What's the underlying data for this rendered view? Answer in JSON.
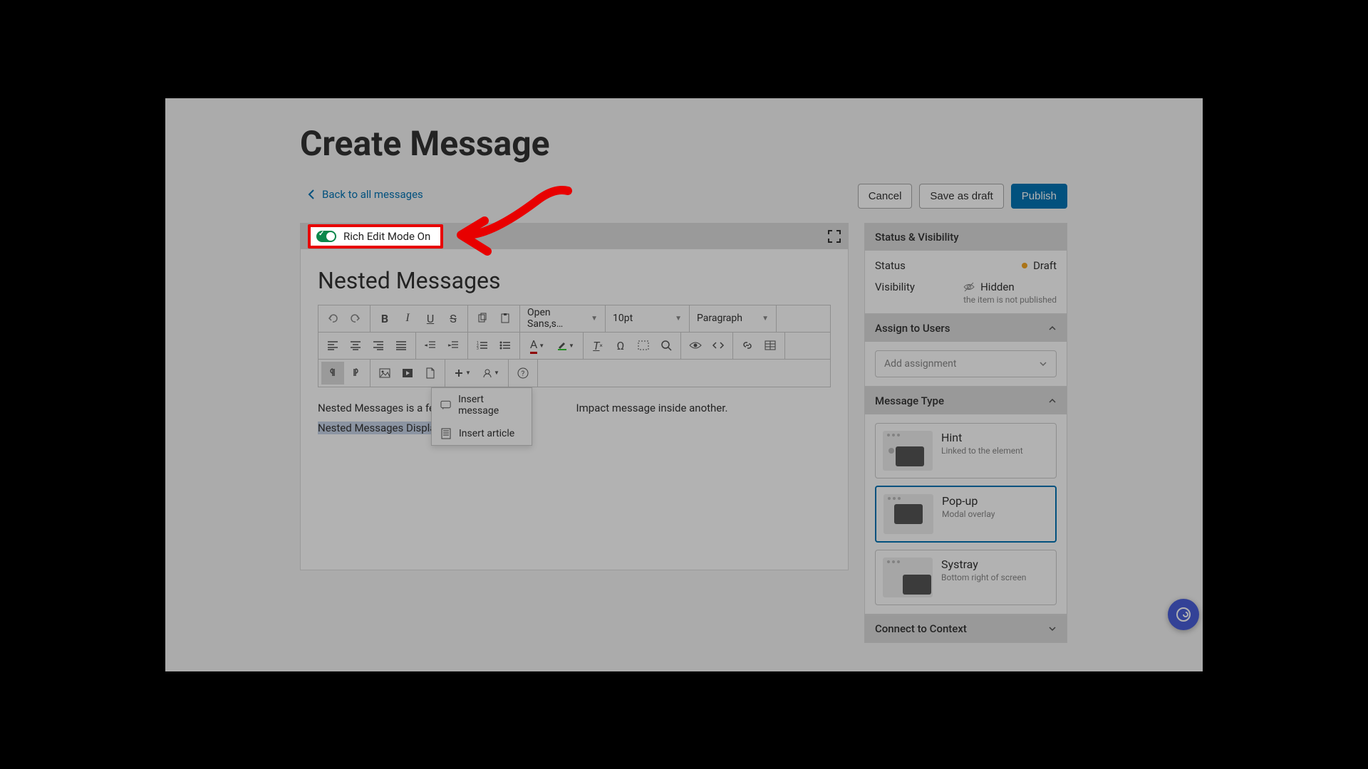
{
  "page": {
    "title": "Create Message"
  },
  "nav": {
    "back": "Back to all messages"
  },
  "actions": {
    "cancel": "Cancel",
    "save_draft": "Save as draft",
    "publish": "Publish"
  },
  "editor": {
    "rich_toggle": "Rich Edit Mode On",
    "title": "Nested Messages",
    "font_family": "Open Sans,s…",
    "font_size": "10pt",
    "block_format": "Paragraph",
    "body_line1_a": "Nested Messages is a feature th",
    "body_line1_b": "Impact message inside another.",
    "body_line2": "Nested Messages Display",
    "dropdown": {
      "insert_message": "Insert message",
      "insert_article": "Insert article"
    }
  },
  "sidebar": {
    "status_visibility": {
      "header": "Status & Visibility",
      "status_label": "Status",
      "status_value": "Draft",
      "visibility_label": "Visibility",
      "visibility_value": "Hidden",
      "visibility_note": "the item is not published"
    },
    "assign": {
      "header": "Assign to Users",
      "placeholder": "Add assignment"
    },
    "message_type": {
      "header": "Message Type",
      "cards": [
        {
          "title": "Hint",
          "desc": "Linked to the element"
        },
        {
          "title": "Pop-up",
          "desc": "Modal overlay"
        },
        {
          "title": "Systray",
          "desc": "Bottom right of screen"
        }
      ]
    },
    "connect": {
      "header": "Connect to Context"
    }
  }
}
